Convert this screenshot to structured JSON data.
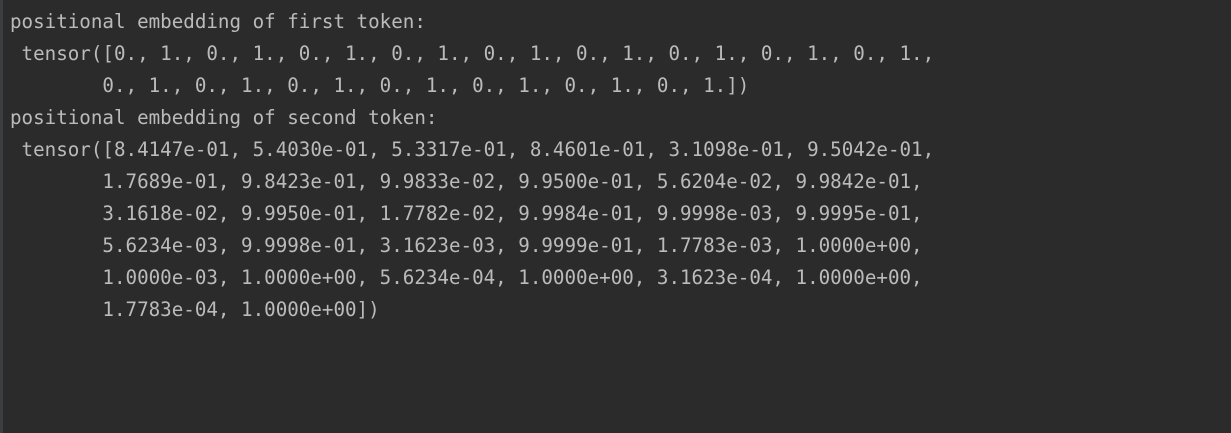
{
  "console": {
    "lines": [
      "positional embedding of first token:",
      " tensor([0., 1., 0., 1., 0., 1., 0., 1., 0., 1., 0., 1., 0., 1., 0., 1., 0., 1.,",
      "        0., 1., 0., 1., 0., 1., 0., 1., 0., 1., 0., 1., 0., 1.])",
      "positional embedding of second token:",
      " tensor([8.4147e-01, 5.4030e-01, 5.3317e-01, 8.4601e-01, 3.1098e-01, 9.5042e-01,",
      "        1.7689e-01, 9.8423e-01, 9.9833e-02, 9.9500e-01, 5.6204e-02, 9.9842e-01,",
      "        3.1618e-02, 9.9950e-01, 1.7782e-02, 9.9984e-01, 9.9998e-03, 9.9995e-01,",
      "        5.6234e-03, 9.9998e-01, 3.1623e-03, 9.9999e-01, 1.7783e-03, 1.0000e+00,",
      "        1.0000e-03, 1.0000e+00, 5.6234e-04, 1.0000e+00, 3.1623e-04, 1.0000e+00,",
      "        1.7783e-04, 1.0000e+00])"
    ]
  },
  "colors": {
    "background": "#2b2b2b",
    "text": "#bbbbbb",
    "gutter": "#3c3f41"
  }
}
